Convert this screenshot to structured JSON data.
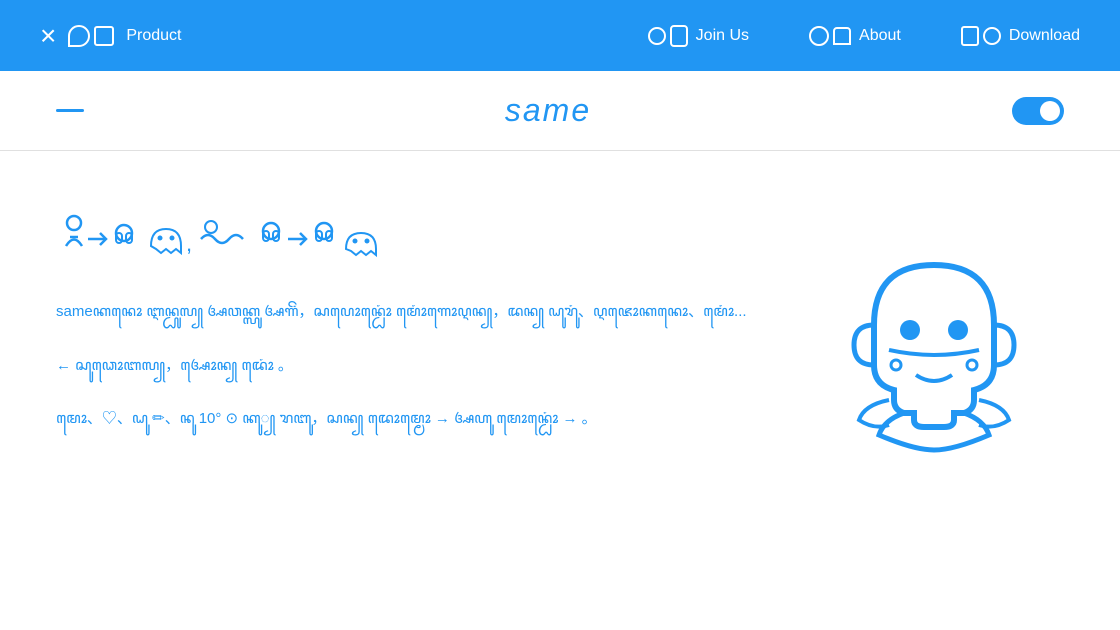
{
  "nav": {
    "close_icon": "×",
    "product_label": "Product",
    "join_label": "Join Us",
    "about_label": "About",
    "download_label": "Download"
  },
  "header": {
    "logo": "same",
    "toggle_state": true
  },
  "content": {
    "heading_text": "ꦬꦤꦸ → ꦏꦠꦼꦩꦺꦴꦠꦤ꧀, ꦥꦿꦢꦺꦴꦒ ꦏꦸꦭꦤꦺꦴ → ꦥꦩ꧀ꦧꦧꦤꦤꦼ",
    "para1": "sameꦏꦤꦺꦴ ꦆꦤ꧀ꦝꦸꦭ꧀ ꦄꦮꦏ꧀ꦭꦸ ꦄꦒꦼꦁ，ꦱꦥꦺꦴꦤ꧀ꦝꦺꦴꦁ ꦩꦺꦴꦁꦒꦺꦴꦉꦤ꧀，ꦢꦤ꧀ ꦝꦸꦫꦸꦁ、ꦉꦗꦺꦴꦏꦤꦺꦴ、ꦩꦺꦴꦁ...",
    "para2": "← ꦱꦸꦣꦺꦴꦧꦭ꧀，ꦄꦺꦴꦤ꧀ ꦢꦺꦴꦁ 。",
    "para3": "ꦩꦺꦴ、♡、ꦝꦸ ✏、ꦤꦸ 10° ⊙ ꦏꦸ꧀ ꦫꦧꦸ，ꦱꦤ꧀ ꦢꦺꦴꦩ꧀ꦩꦺꦴ → ꦄꦲꦸ ꦩꦺꦴꦤ꧀ꦝꦺꦴꦁ → 。"
  }
}
